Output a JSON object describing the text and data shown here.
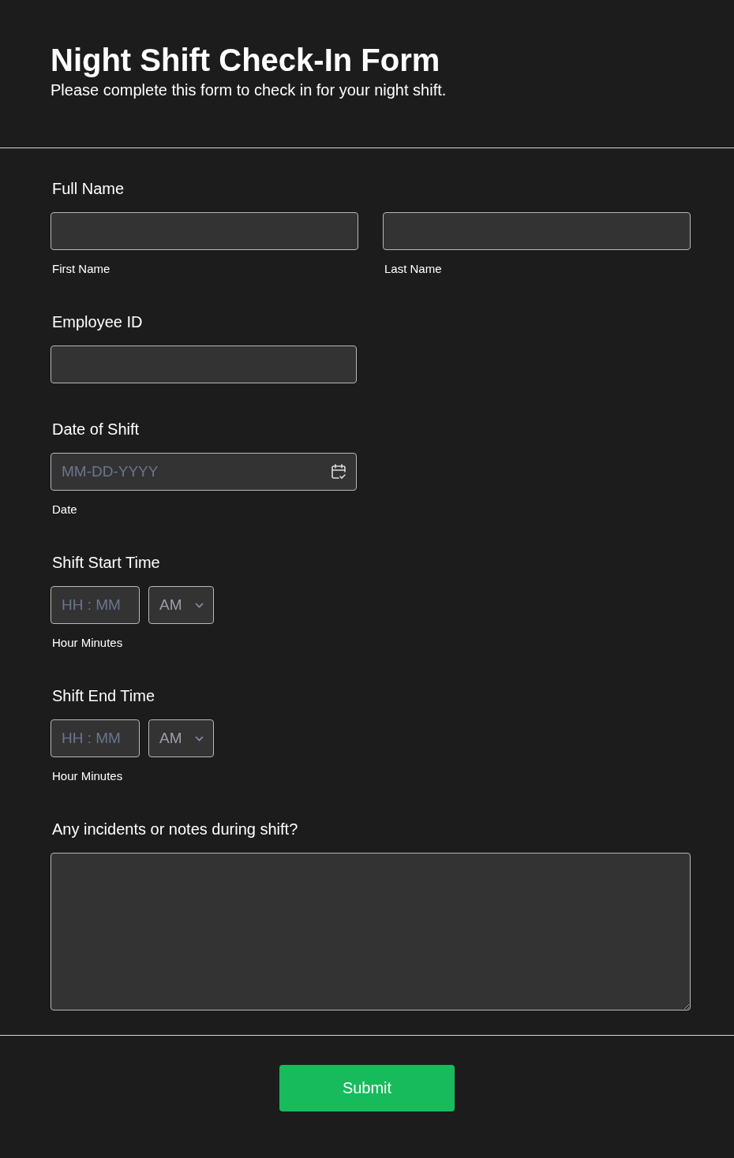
{
  "header": {
    "title": "Night Shift Check-In Form",
    "subtitle": "Please complete this form to check in for your night shift."
  },
  "fields": [
    {
      "kind": "name",
      "label": "Full Name",
      "parts": [
        {
          "sublabel": "First Name"
        },
        {
          "sublabel": "Last Name"
        }
      ]
    },
    {
      "kind": "text",
      "label": "Employee ID"
    },
    {
      "kind": "date",
      "label": "Date of Shift",
      "placeholder": "MM-DD-YYYY",
      "sublabel": "Date"
    },
    {
      "kind": "time",
      "label": "Shift Start Time",
      "placeholder": "HH : MM",
      "period": "AM",
      "sublabel": "Hour Minutes"
    },
    {
      "kind": "time",
      "label": "Shift End Time",
      "placeholder": "HH : MM",
      "period": "AM",
      "sublabel": "Hour Minutes"
    },
    {
      "kind": "textarea",
      "label": "Any incidents or notes during shift?"
    }
  ],
  "submit": {
    "label": "Submit"
  }
}
